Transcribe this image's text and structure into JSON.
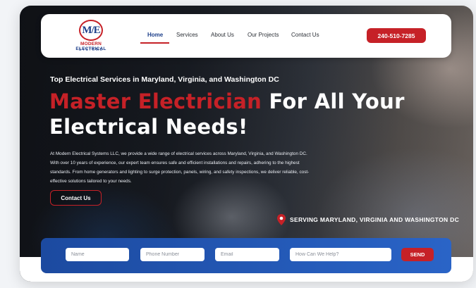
{
  "logo": {
    "monogram": "M/E",
    "brand_red": "MODERN",
    "brand_blue": "ELECTRICAL",
    "subtitle": "SYSTEMS"
  },
  "nav": {
    "items": [
      {
        "label": "Home",
        "active": true
      },
      {
        "label": "Services",
        "active": false
      },
      {
        "label": "About Us",
        "active": false
      },
      {
        "label": "Our Projects",
        "active": false
      },
      {
        "label": "Contact Us",
        "active": false
      }
    ],
    "phone": "240-510-7285"
  },
  "hero": {
    "kicker": "Top Electrical Services in Maryland, Virginia, and Washington DC",
    "headline_red": "Master Electrician",
    "headline_white": "For All Your Electrical Needs!",
    "description": "At Modern Electrical Systems LLC, we provide a wide range of electrical services across Maryland, Virginia, and Washington DC. With over 10 years of experience, our expert team ensures safe and efficient installations and repairs, adhering to the highest standards. From home generators and lighting to surge protection, panels, wiring, and safety inspections, we deliver reliable, cost-effective solutions tailored to your needs.",
    "cta": "Contact Us",
    "serving": "SERVING MARYLAND, VIRGINIA AND WASHINGTON DC"
  },
  "form": {
    "name_placeholder": "Name",
    "phone_placeholder": "Phone Number",
    "email_placeholder": "Email",
    "help_placeholder": "How Can We Help?",
    "send": "SEND"
  },
  "colors": {
    "brand_red": "#c62127",
    "brand_blue": "#1d3f8a",
    "form_blue": "#1c4aa0"
  },
  "icons": {
    "location": "map-pin-icon"
  }
}
